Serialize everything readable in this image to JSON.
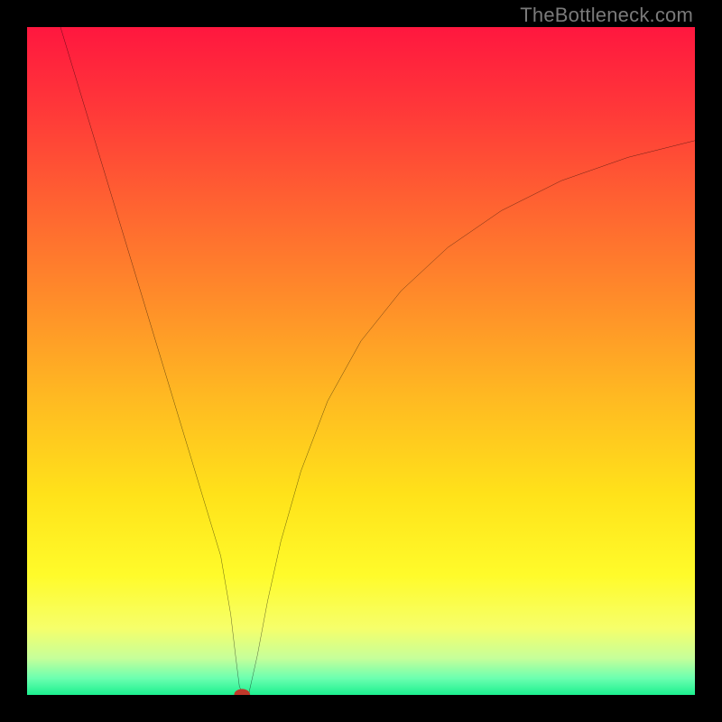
{
  "watermark": "TheBottleneck.com",
  "chart_data": {
    "type": "line",
    "title": "",
    "xlabel": "",
    "ylabel": "",
    "xlim": [
      0,
      100
    ],
    "ylim": [
      0,
      100
    ],
    "grid": false,
    "background_gradient": {
      "stops": [
        {
          "offset": 0.0,
          "color": "#ff173f"
        },
        {
          "offset": 0.12,
          "color": "#ff3739"
        },
        {
          "offset": 0.25,
          "color": "#ff5e32"
        },
        {
          "offset": 0.4,
          "color": "#ff8a2a"
        },
        {
          "offset": 0.55,
          "color": "#ffb822"
        },
        {
          "offset": 0.7,
          "color": "#ffe21a"
        },
        {
          "offset": 0.82,
          "color": "#fffb2a"
        },
        {
          "offset": 0.9,
          "color": "#f6ff6a"
        },
        {
          "offset": 0.945,
          "color": "#c6ff9a"
        },
        {
          "offset": 0.975,
          "color": "#6cffb0"
        },
        {
          "offset": 1.0,
          "color": "#1cf08f"
        }
      ]
    },
    "series": [
      {
        "name": "bottleneck-curve",
        "color": "#000000",
        "width": 2.2,
        "x": [
          5,
          7,
          9,
          11,
          13,
          15,
          17,
          19,
          21,
          23,
          25,
          27,
          29,
          30.5,
          31.2,
          31.8,
          32.4,
          33.2,
          34.5,
          36,
          38,
          41,
          45,
          50,
          56,
          63,
          71,
          80,
          90,
          100
        ],
        "y": [
          100,
          93.4,
          86.8,
          80.2,
          73.6,
          67.0,
          60.4,
          53.8,
          47.2,
          40.6,
          34.0,
          27.4,
          20.8,
          12.0,
          6.0,
          1.2,
          0.2,
          0.2,
          6.0,
          14.0,
          23.0,
          33.5,
          44.0,
          53.0,
          60.5,
          67.0,
          72.5,
          77.0,
          80.5,
          83.0
        ]
      }
    ],
    "marker": {
      "name": "minimum-point",
      "x": 32.2,
      "y": 0.0,
      "rx": 1.2,
      "ry": 0.9,
      "fill": "#c0392b"
    }
  }
}
